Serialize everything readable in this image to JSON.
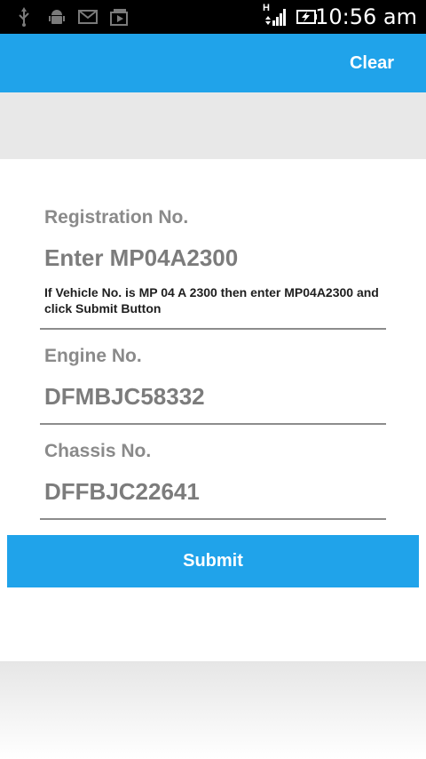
{
  "status_bar": {
    "time": "10:56 am",
    "network_type": "H",
    "icons": [
      "usb-icon",
      "android-debug-icon",
      "mail-icon",
      "media-play-icon",
      "signal-icon",
      "battery-charging-icon"
    ]
  },
  "action_bar": {
    "clear_label": "Clear",
    "color": "#20a3ea"
  },
  "form": {
    "registration": {
      "label": "Registration No.",
      "placeholder": "Enter MP04A2300",
      "hint": "If Vehicle No. is MP 04 A 2300 then enter MP04A2300 and click Submit Button"
    },
    "engine": {
      "label": "Engine No.",
      "value": "DFMBJC58332"
    },
    "chassis": {
      "label": "Chassis No.",
      "value": "DFFBJC22641"
    },
    "submit_label": "Submit"
  }
}
